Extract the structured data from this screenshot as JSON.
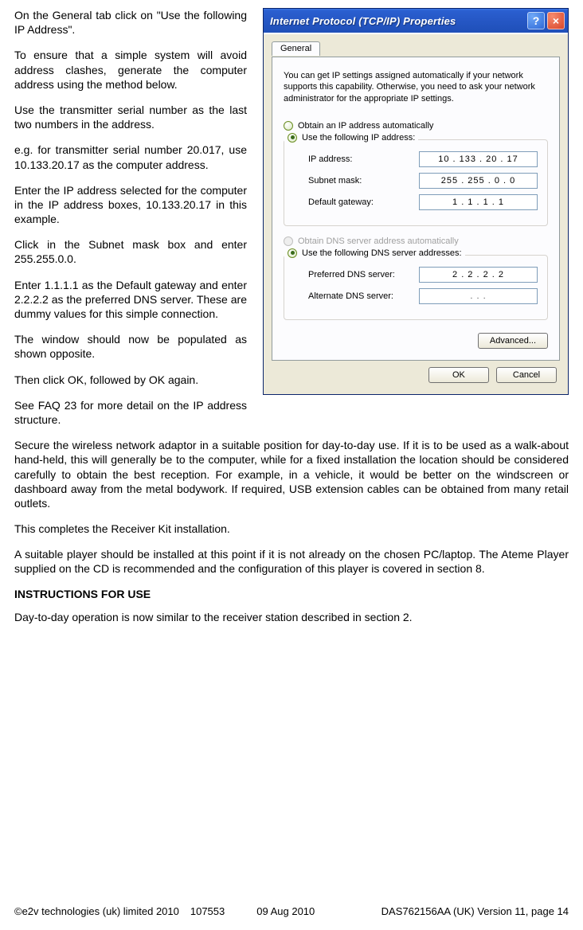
{
  "doc": {
    "leftParas": [
      "On the General tab click on \"Use the following IP Address\".",
      "To ensure that a simple system will avoid address clashes, generate the computer address using the method below.",
      "Use the transmitter serial number as the last two numbers in the address.",
      "e.g. for transmitter serial number 20.017, use 10.133.20.17 as the computer address.",
      "Enter the IP address selected for the computer in the IP address boxes, 10.133.20.17 in this example.",
      "Click in the Subnet mask box and enter 255.255.0.0.",
      "Enter 1.1.1.1 as the Default gateway and enter 2.2.2.2 as the preferred DNS server. These are dummy values for this simple connection.",
      "The window should now be populated as shown opposite.",
      "Then click OK, followed by OK again.",
      "See FAQ 23 for more detail on the IP address structure."
    ],
    "fullParas": [
      "Secure the wireless network adaptor in a suitable position for day-to-day use. If it is to be used as a walk-about hand-held, this will generally be to the computer, while for a fixed installation the location should be considered carefully to obtain the best reception. For example, in a vehicle, it would be better on the windscreen or dashboard away from the metal bodywork. If required, USB extension cables can be obtained from many retail outlets.",
      "This completes the Receiver Kit installation.",
      "A suitable player should be installed at this point if it is not already on the chosen PC/laptop. The Ateme Player supplied on the CD is recommended and the configuration of this player is covered in section 8."
    ],
    "heading": "INSTRUCTIONS FOR USE",
    "afterHeading": "Day-to-day operation is now similar to the receiver station described in section 2."
  },
  "dialog": {
    "title": "Internet Protocol (TCP/IP) Properties",
    "tab": "General",
    "intro": "You can get IP settings assigned automatically if your network supports this capability. Otherwise, you need to ask your network administrator for the appropriate IP settings.",
    "radio_auto_ip": "Obtain an IP address automatically",
    "radio_use_ip": "Use the following IP address:",
    "lbl_ip": "IP address:",
    "lbl_subnet": "Subnet mask:",
    "lbl_gateway": "Default gateway:",
    "val_ip": "10 . 133 .  20  .  17",
    "val_subnet": "255 . 255 .   0   .   0",
    "val_gateway": "1   .   1   .   1   .   1",
    "radio_auto_dns": "Obtain DNS server address automatically",
    "radio_use_dns": "Use the following DNS server addresses:",
    "lbl_pref_dns": "Preferred DNS server:",
    "lbl_alt_dns": "Alternate DNS server:",
    "val_pref_dns": "2   .   2   .   2   .   2",
    "val_alt_dns": ".        .        .",
    "btn_advanced": "Advanced...",
    "btn_ok": "OK",
    "btn_cancel": "Cancel"
  },
  "footer": {
    "copyright": "©e2v technologies (uk) limited 2010",
    "docnum": "107553",
    "date": "09 Aug 2010",
    "pageid": "DAS762156AA (UK) Version 11, page 14"
  }
}
